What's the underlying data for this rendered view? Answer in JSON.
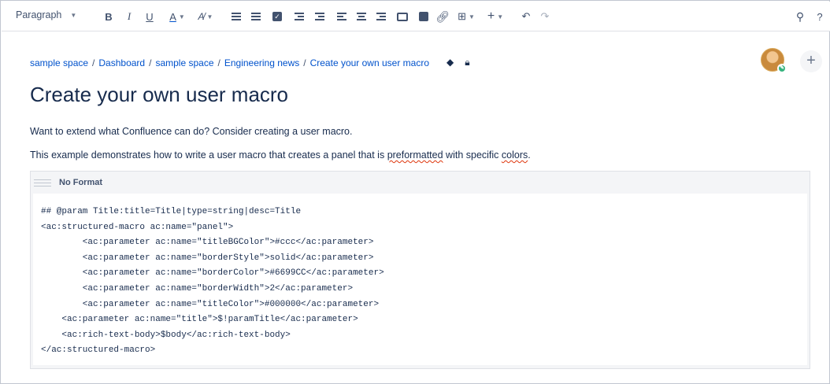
{
  "toolbar": {
    "paragraph_label": "Paragraph",
    "items": [
      "bold-button",
      "italic-button",
      "underline-button",
      "text-color-button",
      "format-button",
      "bullet-list-button",
      "number-list-button",
      "task-list-button",
      "outdent-button",
      "indent-button",
      "align-left-button",
      "align-center-button",
      "align-right-button",
      "layout-button",
      "image-button",
      "link-button",
      "table-button",
      "insert-button",
      "undo-button",
      "redo-button"
    ],
    "right": [
      "search-button",
      "help-button"
    ]
  },
  "breadcrumb": [
    "sample space",
    "Dashboard",
    "sample space",
    "Engineering news",
    "Create your own user macro"
  ],
  "page": {
    "title": "Create your own user macro",
    "para1": "Want to extend what Confluence can do?  Consider creating a user macro.",
    "para2_start": "This example demonstrates how to write a user macro that creates a panel that is ",
    "para2_word1": "preformatted",
    "para2_mid": " with specific ",
    "para2_word2": "colors",
    "para2_end": "."
  },
  "macro": {
    "label": "No Format",
    "lines": [
      "## @param Title:title=Title|type=string|desc=Title",
      "<ac:structured-macro ac:name=\"panel\">",
      "        <ac:parameter ac:name=\"titleBGColor\">#ccc</ac:parameter>",
      "        <ac:parameter ac:name=\"borderStyle\">solid</ac:parameter>",
      "        <ac:parameter ac:name=\"borderColor\">#6699CC</ac:parameter>",
      "        <ac:parameter ac:name=\"borderWidth\">2</ac:parameter>",
      "        <ac:parameter ac:name=\"titleColor\">#000000</ac:parameter>",
      "    <ac:parameter ac:name=\"title\">$!paramTitle</ac:parameter>",
      "    <ac:rich-text-body>$body</ac:rich-text-body>",
      "</ac:structured-macro>"
    ]
  },
  "colors": {
    "link": "#0052cc",
    "text": "#172b4d",
    "panel": "#f4f5f7",
    "spell": "#de350b"
  }
}
